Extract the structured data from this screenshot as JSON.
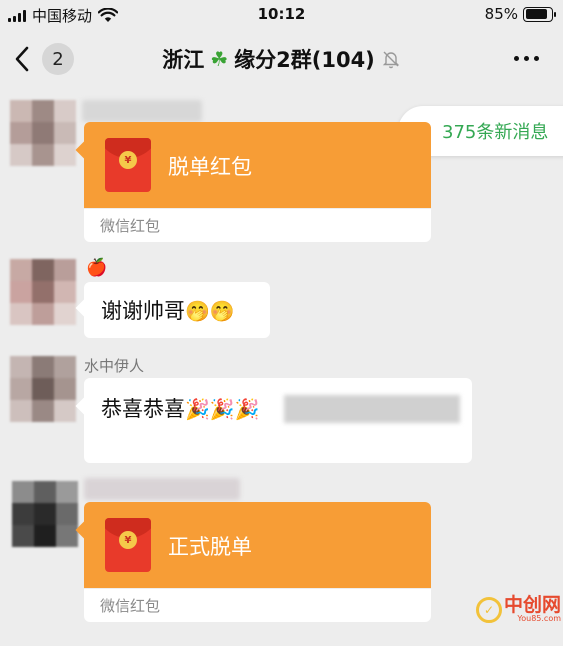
{
  "status_bar": {
    "carrier": "中国移动",
    "time": "10:12",
    "battery": "85%",
    "battery_level": 0.85
  },
  "nav": {
    "back_count": "2",
    "chat_title": "浙江☘️缘分2群(104)",
    "title_prefix": "浙江",
    "title_clover": "☘",
    "title_suffix": "缘分2群(104)"
  },
  "new_messages": {
    "label": "375条新消息"
  },
  "messages": [
    {
      "type": "red_packet",
      "title": "脱单红包",
      "footer": "微信红包"
    },
    {
      "type": "text",
      "sender": "🍎",
      "text": "谢谢帅哥",
      "emojis": "🤭🤭"
    },
    {
      "type": "text",
      "sender": "水中伊人",
      "text": "恭喜恭喜",
      "emojis": "🎉🎉🎉"
    },
    {
      "type": "red_packet",
      "title": "正式脱单",
      "footer": "微信红包"
    }
  ],
  "watermark": {
    "cn": "中创网",
    "en": "You85.com"
  },
  "colors": {
    "red_packet": "#f79d36",
    "envelope": "#e83a2a",
    "accent_green": "#34a853",
    "background": "#ededed"
  },
  "icons": [
    "signal-icon",
    "wifi-icon",
    "battery-icon",
    "back-chevron-icon",
    "mute-bell-icon",
    "more-icon",
    "double-chevron-up-icon",
    "red-envelope-icon"
  ]
}
